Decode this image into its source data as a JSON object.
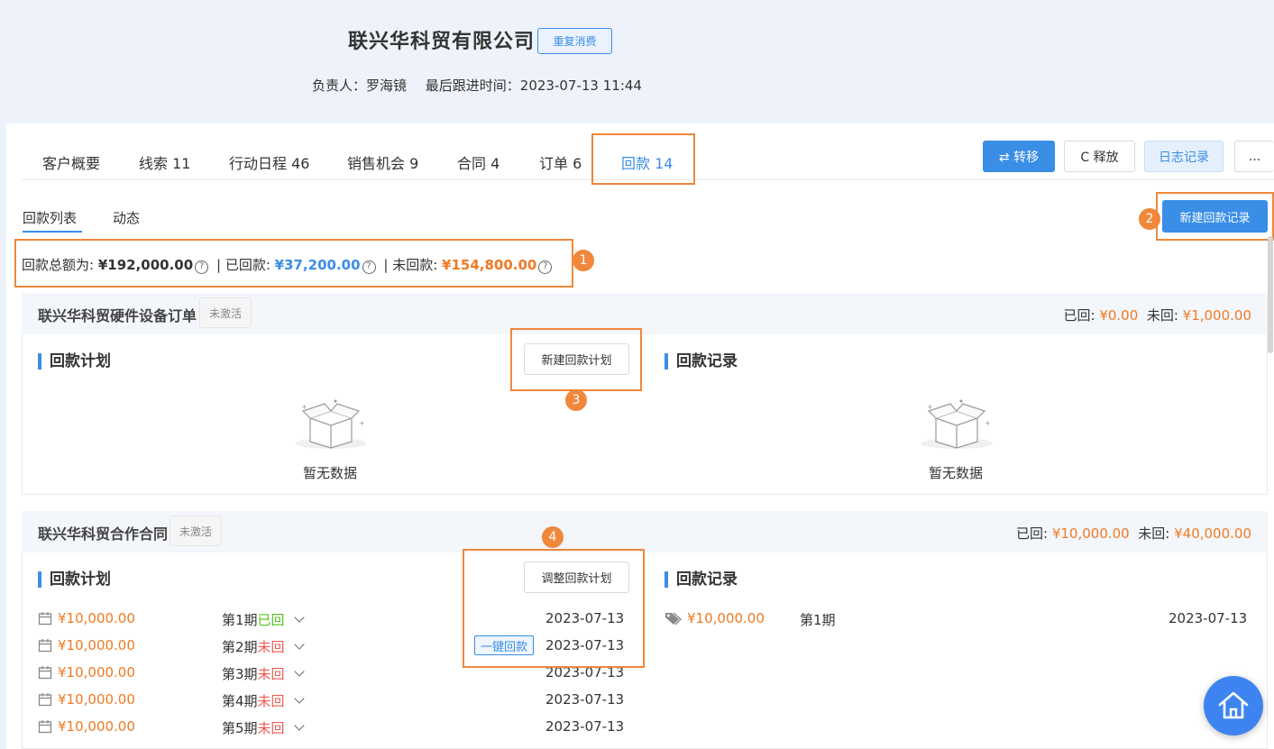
{
  "header": {
    "company": "联兴华科贸有限公司",
    "tag": "重复消费",
    "owner": "负责人：罗海镜",
    "last_follow": "最后跟进时间：2023-07-13 11:44"
  },
  "tabs": [
    "客户概要",
    "线索 11",
    "行动日程 46",
    "销售机会 9",
    "合同 4",
    "订单 6",
    "回款 14"
  ],
  "actions": {
    "transfer": "⇄ 转移",
    "release": "C 释放",
    "log": "日志记录",
    "more": "..."
  },
  "subtabs": [
    "回款列表",
    "动态"
  ],
  "new_record_button": "新建回款记录",
  "summary": {
    "total_label": "回款总额为:",
    "total_value": "¥192,000.00",
    "paid_label": "已回款:",
    "paid_value": "¥37,200.00",
    "unpaid_label": "未回款:",
    "unpaid_value": "¥154,800.00",
    "separator": "|"
  },
  "badges": [
    "1",
    "2",
    "3",
    "4"
  ],
  "sections": [
    {
      "title": "联兴华科贸硬件设备订单",
      "status": "未激活",
      "paid_label": "已回:",
      "paid": "¥0.00",
      "unpaid_label": "未回:",
      "unpaid": "¥1,000.00",
      "plan_title": "回款计划",
      "plan_button": "新建回款计划",
      "record_title": "回款记录",
      "empty_text": "暂无数据"
    },
    {
      "title": "联兴华科贸合作合同",
      "status": "未激活",
      "paid_label": "已回:",
      "paid": "¥10,000.00",
      "unpaid_label": "未回:",
      "unpaid": "¥40,000.00",
      "plan_title": "回款计划",
      "plan_button": "调整回款计划",
      "record_title": "回款记录",
      "one_key": "一键回款",
      "plans": [
        {
          "amount": "¥10,000.00",
          "period": "第1期",
          "status": "已回",
          "date": "2023-07-13"
        },
        {
          "amount": "¥10,000.00",
          "period": "第2期",
          "status": "未回",
          "date": "2023-07-13"
        },
        {
          "amount": "¥10,000.00",
          "period": "第3期",
          "status": "未回",
          "date": "2023-07-13"
        },
        {
          "amount": "¥10,000.00",
          "period": "第4期",
          "status": "未回",
          "date": "2023-07-13"
        },
        {
          "amount": "¥10,000.00",
          "period": "第5期",
          "status": "未回",
          "date": "2023-07-13"
        }
      ],
      "records": [
        {
          "amount": "¥10,000.00",
          "period": "第1期",
          "date": "2023-07-13"
        }
      ]
    }
  ],
  "colors": {
    "accent": "#3a8ee6",
    "highlight": "#f0873a",
    "amount": "#f07a22",
    "unpaid": "#ee5a52",
    "paid": "#52c41a"
  }
}
